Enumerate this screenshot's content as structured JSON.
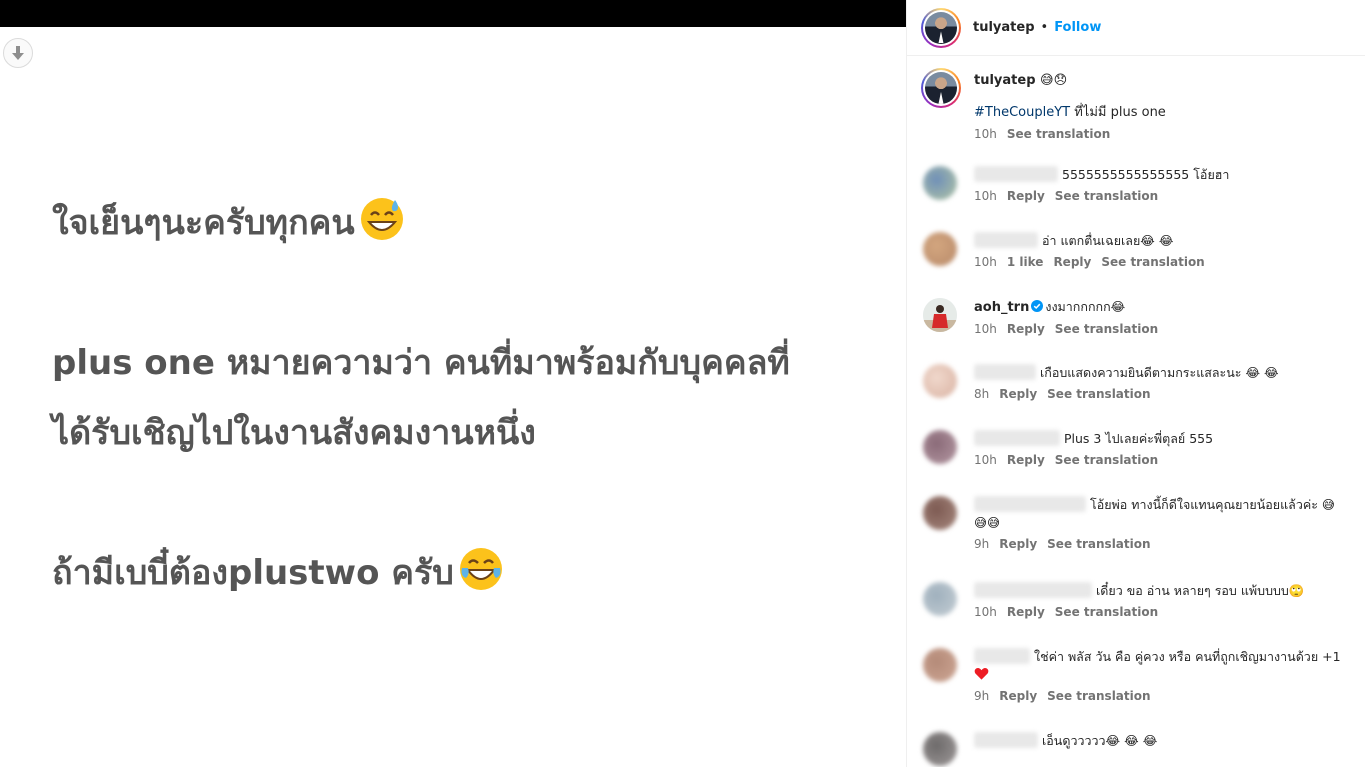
{
  "post": {
    "line1": "ใจเย็นๆนะครับทุกคน",
    "line2": "plus one หมายความว่า คนที่มาพร้อมกับบุคคลที่",
    "line3": "ได้รับเชิญไปในงานสังคมงานหนึ่ง",
    "line4": "ถ้ามีเบบี๋ต้องplustwo ครับ",
    "emoji1": "sweat-smile-emoji",
    "emoji2": "tears-of-joy-emoji"
  },
  "header": {
    "username": "tulyatep",
    "dot": "•",
    "follow": "Follow"
  },
  "caption": {
    "username": "tulyatep",
    "emojis": "😅😞",
    "hashtag": "#TheCoupleYT",
    "text": " ที่ไม่มี plus one",
    "time": "10h",
    "see_translation": "See translation"
  },
  "comments": [
    {
      "text": "5555555555555555 โอ้ยฮา",
      "time": "10h",
      "reply": "Reply",
      "see_translation": "See translation"
    },
    {
      "text": "อ่า แตกตื่นเฉยเลย😂 😂",
      "time": "10h",
      "likes": "1 like",
      "reply": "Reply",
      "see_translation": "See translation"
    },
    {
      "username": "aoh_trn",
      "text": "งงมากกกกก😂",
      "time": "10h",
      "reply": "Reply",
      "see_translation": "See translation"
    },
    {
      "text": "เกือบแสดงความยินดีตามกระแสละนะ 😂 😂",
      "time": "8h",
      "reply": "Reply",
      "see_translation": "See translation"
    },
    {
      "text": "Plus 3 ไปเลยค่ะพี่ตุลย์ 555",
      "time": "10h",
      "reply": "Reply",
      "see_translation": "See translation"
    },
    {
      "text": "โอ้ยพ่อ ทางนี้ก็ดีใจแทนคุณยายน้อยแล้วค่ะ 😅",
      "text2": "😅😅",
      "time": "9h",
      "reply": "Reply",
      "see_translation": "See translation"
    },
    {
      "text": "เดี๋ยว ขอ อ่าน หลายๆ รอบ แพ้บบบบ🙄",
      "time": "10h",
      "reply": "Reply",
      "see_translation": "See translation"
    },
    {
      "text": "ใช่ค่า พลัส วัน คือ คู่ควง หรือ คนที่ถูกเชิญมางานด้วย +1",
      "time": "9h",
      "reply": "Reply",
      "see_translation": "See translation"
    },
    {
      "text": "เอ็นดูววววว😂 😂 😂"
    }
  ],
  "colors": {
    "accent": "#0095f6",
    "hashtag": "#00376b",
    "verified": "#0095f6",
    "heart": "#ed1c24"
  }
}
